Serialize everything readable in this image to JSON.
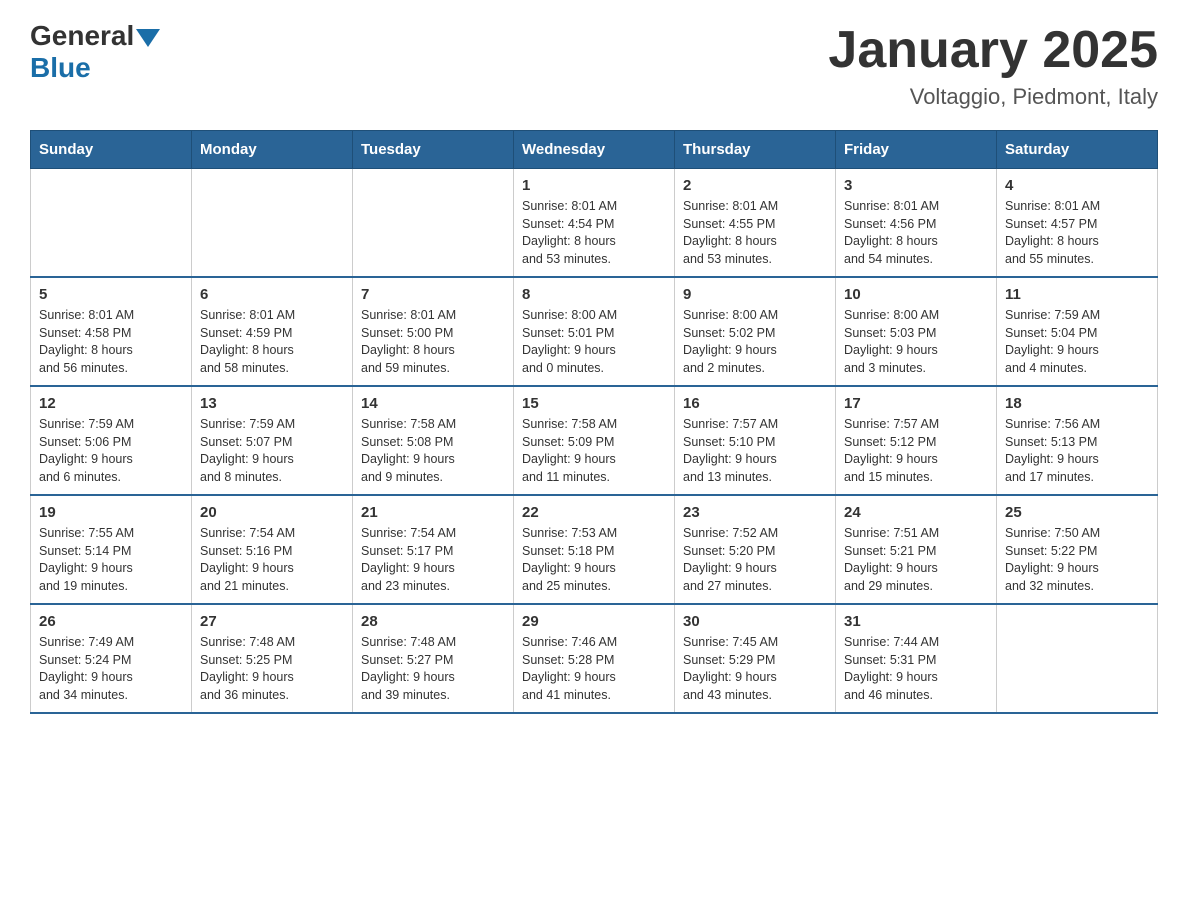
{
  "header": {
    "logo_general": "General",
    "logo_blue": "Blue",
    "month_title": "January 2025",
    "location": "Voltaggio, Piedmont, Italy"
  },
  "weekdays": [
    "Sunday",
    "Monday",
    "Tuesday",
    "Wednesday",
    "Thursday",
    "Friday",
    "Saturday"
  ],
  "weeks": [
    [
      {
        "day": "",
        "info": ""
      },
      {
        "day": "",
        "info": ""
      },
      {
        "day": "",
        "info": ""
      },
      {
        "day": "1",
        "info": "Sunrise: 8:01 AM\nSunset: 4:54 PM\nDaylight: 8 hours\nand 53 minutes."
      },
      {
        "day": "2",
        "info": "Sunrise: 8:01 AM\nSunset: 4:55 PM\nDaylight: 8 hours\nand 53 minutes."
      },
      {
        "day": "3",
        "info": "Sunrise: 8:01 AM\nSunset: 4:56 PM\nDaylight: 8 hours\nand 54 minutes."
      },
      {
        "day": "4",
        "info": "Sunrise: 8:01 AM\nSunset: 4:57 PM\nDaylight: 8 hours\nand 55 minutes."
      }
    ],
    [
      {
        "day": "5",
        "info": "Sunrise: 8:01 AM\nSunset: 4:58 PM\nDaylight: 8 hours\nand 56 minutes."
      },
      {
        "day": "6",
        "info": "Sunrise: 8:01 AM\nSunset: 4:59 PM\nDaylight: 8 hours\nand 58 minutes."
      },
      {
        "day": "7",
        "info": "Sunrise: 8:01 AM\nSunset: 5:00 PM\nDaylight: 8 hours\nand 59 minutes."
      },
      {
        "day": "8",
        "info": "Sunrise: 8:00 AM\nSunset: 5:01 PM\nDaylight: 9 hours\nand 0 minutes."
      },
      {
        "day": "9",
        "info": "Sunrise: 8:00 AM\nSunset: 5:02 PM\nDaylight: 9 hours\nand 2 minutes."
      },
      {
        "day": "10",
        "info": "Sunrise: 8:00 AM\nSunset: 5:03 PM\nDaylight: 9 hours\nand 3 minutes."
      },
      {
        "day": "11",
        "info": "Sunrise: 7:59 AM\nSunset: 5:04 PM\nDaylight: 9 hours\nand 4 minutes."
      }
    ],
    [
      {
        "day": "12",
        "info": "Sunrise: 7:59 AM\nSunset: 5:06 PM\nDaylight: 9 hours\nand 6 minutes."
      },
      {
        "day": "13",
        "info": "Sunrise: 7:59 AM\nSunset: 5:07 PM\nDaylight: 9 hours\nand 8 minutes."
      },
      {
        "day": "14",
        "info": "Sunrise: 7:58 AM\nSunset: 5:08 PM\nDaylight: 9 hours\nand 9 minutes."
      },
      {
        "day": "15",
        "info": "Sunrise: 7:58 AM\nSunset: 5:09 PM\nDaylight: 9 hours\nand 11 minutes."
      },
      {
        "day": "16",
        "info": "Sunrise: 7:57 AM\nSunset: 5:10 PM\nDaylight: 9 hours\nand 13 minutes."
      },
      {
        "day": "17",
        "info": "Sunrise: 7:57 AM\nSunset: 5:12 PM\nDaylight: 9 hours\nand 15 minutes."
      },
      {
        "day": "18",
        "info": "Sunrise: 7:56 AM\nSunset: 5:13 PM\nDaylight: 9 hours\nand 17 minutes."
      }
    ],
    [
      {
        "day": "19",
        "info": "Sunrise: 7:55 AM\nSunset: 5:14 PM\nDaylight: 9 hours\nand 19 minutes."
      },
      {
        "day": "20",
        "info": "Sunrise: 7:54 AM\nSunset: 5:16 PM\nDaylight: 9 hours\nand 21 minutes."
      },
      {
        "day": "21",
        "info": "Sunrise: 7:54 AM\nSunset: 5:17 PM\nDaylight: 9 hours\nand 23 minutes."
      },
      {
        "day": "22",
        "info": "Sunrise: 7:53 AM\nSunset: 5:18 PM\nDaylight: 9 hours\nand 25 minutes."
      },
      {
        "day": "23",
        "info": "Sunrise: 7:52 AM\nSunset: 5:20 PM\nDaylight: 9 hours\nand 27 minutes."
      },
      {
        "day": "24",
        "info": "Sunrise: 7:51 AM\nSunset: 5:21 PM\nDaylight: 9 hours\nand 29 minutes."
      },
      {
        "day": "25",
        "info": "Sunrise: 7:50 AM\nSunset: 5:22 PM\nDaylight: 9 hours\nand 32 minutes."
      }
    ],
    [
      {
        "day": "26",
        "info": "Sunrise: 7:49 AM\nSunset: 5:24 PM\nDaylight: 9 hours\nand 34 minutes."
      },
      {
        "day": "27",
        "info": "Sunrise: 7:48 AM\nSunset: 5:25 PM\nDaylight: 9 hours\nand 36 minutes."
      },
      {
        "day": "28",
        "info": "Sunrise: 7:48 AM\nSunset: 5:27 PM\nDaylight: 9 hours\nand 39 minutes."
      },
      {
        "day": "29",
        "info": "Sunrise: 7:46 AM\nSunset: 5:28 PM\nDaylight: 9 hours\nand 41 minutes."
      },
      {
        "day": "30",
        "info": "Sunrise: 7:45 AM\nSunset: 5:29 PM\nDaylight: 9 hours\nand 43 minutes."
      },
      {
        "day": "31",
        "info": "Sunrise: 7:44 AM\nSunset: 5:31 PM\nDaylight: 9 hours\nand 46 minutes."
      },
      {
        "day": "",
        "info": ""
      }
    ]
  ]
}
